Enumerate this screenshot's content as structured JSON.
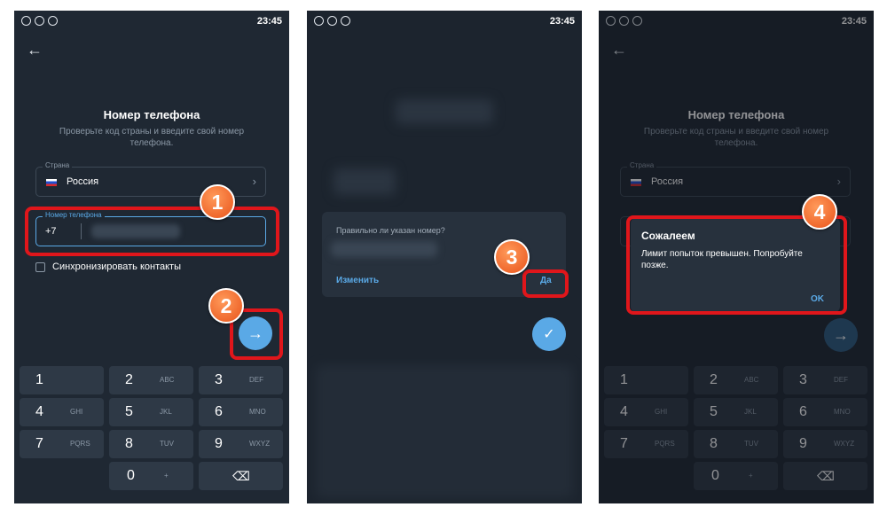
{
  "status_time": "23:45",
  "screen1": {
    "title": "Номер телефона",
    "subtitle": "Проверьте код страны и введите свой номер телефона.",
    "country_label": "Страна",
    "country_value": "Россия",
    "phone_label": "Номер телефона",
    "phone_code": "+7",
    "sync_label": "Синхронизировать контакты",
    "next_icon": "arrow-right-icon"
  },
  "keypad": [
    {
      "digit": "1",
      "letters": ""
    },
    {
      "digit": "2",
      "letters": "ABC"
    },
    {
      "digit": "3",
      "letters": "DEF"
    },
    {
      "digit": "4",
      "letters": "GHI"
    },
    {
      "digit": "5",
      "letters": "JKL"
    },
    {
      "digit": "6",
      "letters": "MNO"
    },
    {
      "digit": "7",
      "letters": "PQRS"
    },
    {
      "digit": "8",
      "letters": "TUV"
    },
    {
      "digit": "9",
      "letters": "WXYZ"
    },
    {
      "digit": "",
      "letters": ""
    },
    {
      "digit": "0",
      "letters": "+"
    },
    {
      "digit": "⌫",
      "letters": ""
    }
  ],
  "screen2": {
    "question": "Правильно ли указан номер?",
    "edit_label": "Изменить",
    "confirm_label": "Да"
  },
  "screen3": {
    "dialog_title": "Сожалеем",
    "dialog_message": "Лимит попыток превышен. Попробуйте позже.",
    "ok_label": "OK"
  },
  "annotations": [
    "1",
    "2",
    "3",
    "4"
  ],
  "colors": {
    "accent": "#5aa9e6",
    "highlight": "#e0161b",
    "badge": "#e9531a",
    "background": "#1f2833"
  }
}
